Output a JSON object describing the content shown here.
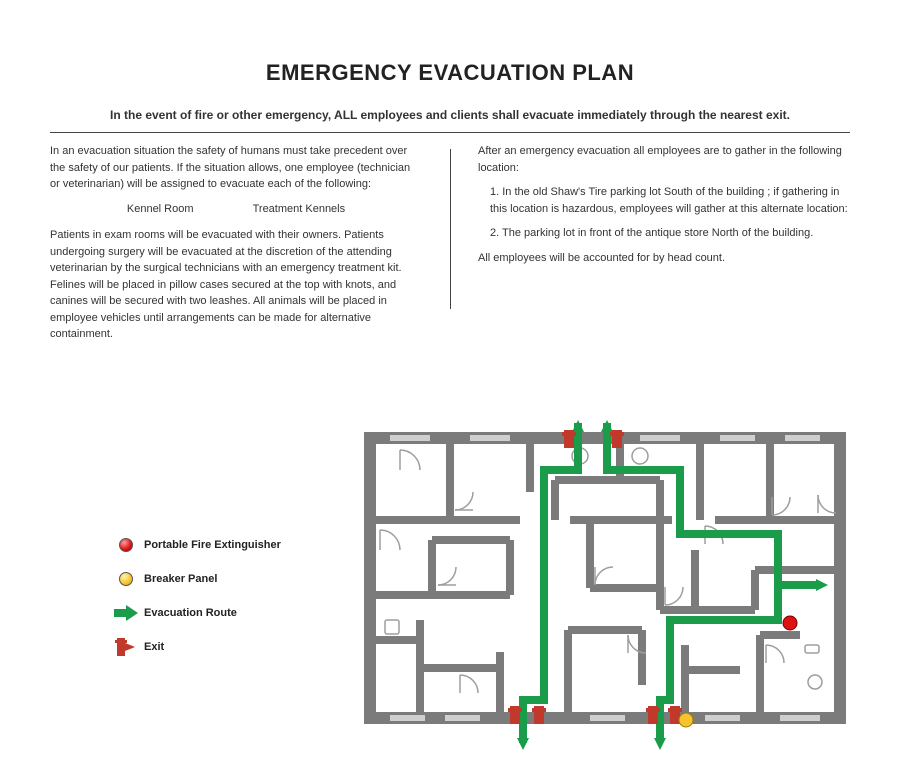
{
  "title": "EMERGENCY EVACUATION PLAN",
  "subtitle": "In the event of fire or other emergency, ALL employees and clients shall evacuate immediately through the nearest exit.",
  "left": {
    "p1": "In an evacuation situation the safety of humans must take precedent over the safety of our patients. If the situation allows, one employee (technician or veterinarian) will be assigned to evacuate each of the following:",
    "room1": "Kennel Room",
    "room2": "Treatment Kennels",
    "p2": "Patients in exam rooms will be evacuated with their owners. Patients undergoing surgery will be evacuated at the discretion of the attending veterinarian by the surgical technicians with an emergency treatment kit. Felines will be placed in pillow cases secured at the top with knots, and canines will be secured with two leashes. All animals will be placed in employee vehicles until arrangements can be made for alternative containment."
  },
  "right": {
    "p1": "After an emergency evacuation all employees are to gather in the following location:",
    "li1": "1.   In the old Shaw's Tire parking lot South of the building ; if gathering in this location is hazardous, employees will gather at this alternate location:",
    "li2": "2.  The parking lot in front of the antique store North of the building.",
    "p2": "All employees will be accounted for by head count."
  },
  "legend": {
    "ext": "Portable Fire Extinguisher",
    "brk": "Breaker Panel",
    "route": "Evacuation Route",
    "exit": "Exit"
  }
}
